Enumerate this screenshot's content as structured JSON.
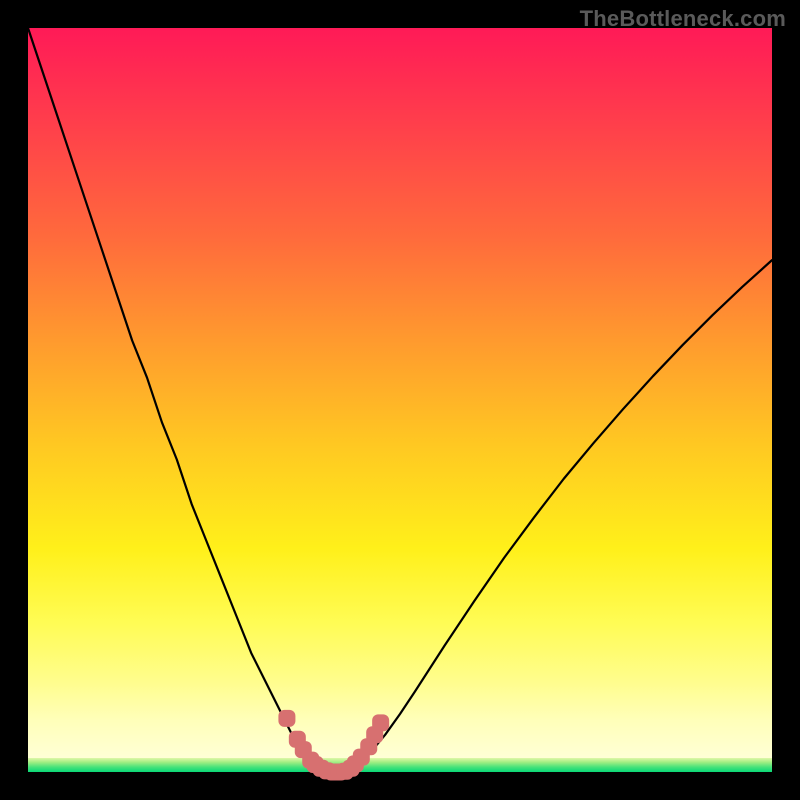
{
  "attribution": "TheBottleneck.com",
  "colors": {
    "frame": "#000000",
    "gradient_top": "#ff1a57",
    "gradient_mid": "#ffe014",
    "gradient_bottom": "#ffffe0",
    "green_band": "#09d877",
    "curve_stroke": "#000000",
    "marker_fill": "#d77070",
    "marker_stroke": "#c65c5c"
  },
  "chart_data": {
    "type": "line",
    "title": "",
    "xlabel": "",
    "ylabel": "",
    "xlim": [
      0,
      100
    ],
    "ylim": [
      0,
      100
    ],
    "x": [
      0,
      2,
      4,
      6,
      8,
      10,
      12,
      14,
      16,
      18,
      20,
      22,
      24,
      26,
      28,
      30,
      32,
      34,
      36,
      37,
      38,
      39,
      40,
      41,
      42,
      43,
      44,
      46,
      48,
      50,
      52,
      56,
      60,
      64,
      68,
      72,
      76,
      80,
      84,
      88,
      92,
      96,
      100
    ],
    "y": [
      100,
      94,
      88,
      82,
      76,
      70,
      64,
      58,
      53,
      47,
      42,
      36,
      31,
      26,
      21,
      16,
      12,
      8,
      4,
      2.4,
      1.2,
      0.4,
      0,
      0,
      0,
      0.3,
      0.9,
      2.6,
      5,
      7.8,
      10.8,
      17,
      23,
      28.8,
      34.2,
      39.4,
      44.2,
      48.8,
      53.2,
      57.4,
      61.4,
      65.2,
      68.8
    ],
    "markers": {
      "x": [
        34.8,
        36.2,
        37.0,
        38.0,
        38.6,
        39.4,
        40.2,
        41.0,
        41.8,
        42.6,
        43.4,
        44.0,
        44.8,
        45.8,
        46.6,
        47.4
      ],
      "y": [
        7.2,
        4.4,
        3.0,
        1.6,
        1.0,
        0.5,
        0.15,
        0.0,
        0.0,
        0.1,
        0.5,
        1.1,
        2.0,
        3.4,
        5.0,
        6.6
      ]
    },
    "legend": [],
    "grid": false
  }
}
